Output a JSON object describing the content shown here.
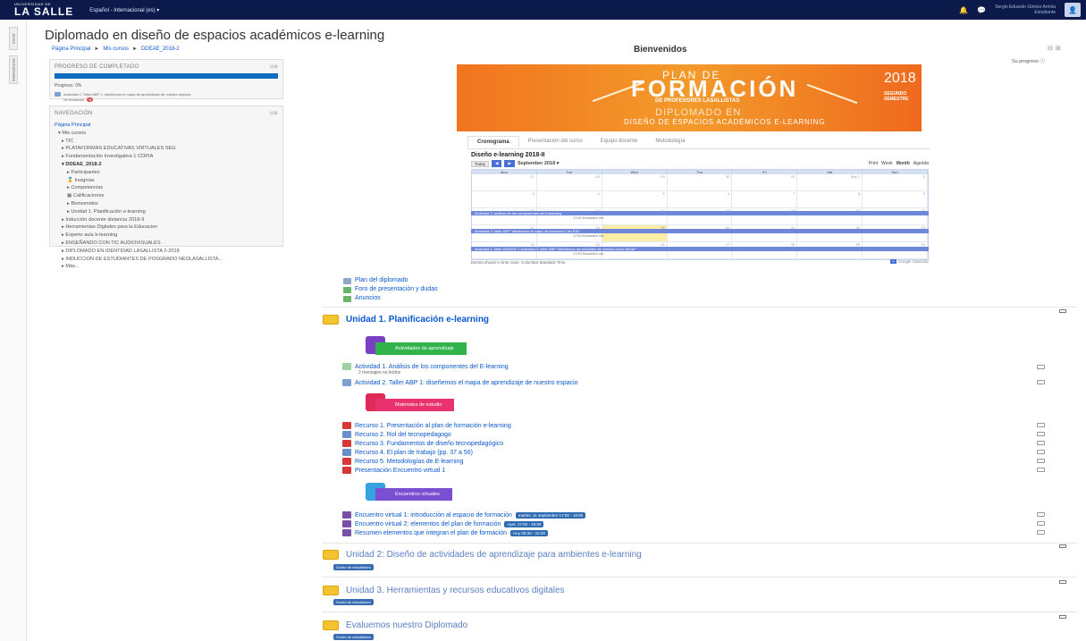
{
  "topbar": {
    "logo_top": "UNIVERSIDAD DE",
    "logo_main": "LA SALLE",
    "language": "Español - Internacional (es) ▾",
    "user_name": "Sergio Eduardo Gómez Arriola",
    "user_role": "Estudiante"
  },
  "rail": {
    "tab1": "Cerrar",
    "tab2": "Administración"
  },
  "page": {
    "title": "Diplomado en diseño de espacios académicos e-learning",
    "breadcrumb": [
      "Página Principal",
      "Mis cursos",
      "DDEAE_2018-2"
    ],
    "welcome": "Bienvenidos",
    "su_progreso": "Su progreso ⓘ"
  },
  "progress_block": {
    "title": "PROGRESO DE COMPLETADO",
    "progress_text": "Progreso: 0%",
    "item": "Actividad 2. Taller ABP 1: diseñemos el mapa de aprendizaje de nuestro espacio",
    "not_done": "No finalizado"
  },
  "nav_block": {
    "title": "NAVEGACIÓN",
    "items": [
      "Página Principal",
      "▾ Mis cursos",
      "▸ TIC",
      "▸ PLATAFORMAS EDUCATIVAS VIRTUALES SEG",
      "▸ Fundamentación Investigativa 1 COPIA",
      "▾ DDEAE_2018-2",
      "▸ Participantes",
      "🏅 Insignias",
      "▸ Competencias",
      "▦ Calificaciones",
      "▸ Bienvenidos",
      "▸ Unidad 1. Planificación e-learning",
      "▸ Inducción docente distancia 2018-II",
      "▸ Herramientas Digitales para la Educacion",
      "▸ Experto aula b-learning",
      "▸ ENSEÑANDO CON TIC AUDIOVISUALES",
      "▸ DIPLOMADO EN IDENTIDAD LASALLISTA 2-2018",
      "▸ INDUCCION DE ESTUDIANTES DE POSGRADO NEOLASALLISTA...",
      "▸ Más..."
    ]
  },
  "banner": {
    "line1": "PLAN DE",
    "line2": "FORMACIÓN",
    "line3": "DE PROFESORES LASALLISTAS",
    "line4": "DIPLOMADO EN",
    "line5": "DISEÑO DE ESPACIOS ACADÉMICOS E-LEARNING",
    "year": "2018",
    "semester": "SEGUNDO SEMESTRE"
  },
  "tabs": [
    "Cronograma",
    "Presentación del curso",
    "Equipo docente",
    "Metodología"
  ],
  "calendar": {
    "title": "Diseño e-learning 2018-II",
    "today": "Today",
    "month": "September 2018 ▾",
    "print": "Print",
    "views": [
      "Week",
      "Month",
      "Agenda"
    ],
    "days": [
      "Mon",
      "Tue",
      "Wed",
      "Thu",
      "Fri",
      "Sat",
      "Sun"
    ],
    "weeks": [
      [
        "27",
        "28",
        "29",
        "30",
        "31",
        "Sep 1",
        "2"
      ],
      [
        "3",
        "4",
        "5",
        "6",
        "7",
        "8",
        "9"
      ],
      [
        "10",
        "11",
        "12",
        "13",
        "14",
        "15",
        "16"
      ],
      [
        "17",
        "18",
        "19",
        "20",
        "21",
        "22",
        "23"
      ],
      [
        "24",
        "25",
        "26",
        "27",
        "28",
        "29",
        "30"
      ]
    ],
    "event1": "Actividad 1: análisis de los componentes del e-learning",
    "event1_sub": "17:00 Encuentro virt",
    "event2": "Actividad 2: taller ABP \"diseñemos el mapa de formación\" del EAV",
    "event2_sub": "17:00 Encuentro virt",
    "event3": "Actividad 2: taller AVANCE 1 Actividad 3: taller ABP \"diseñemos las unidades de nuestro curso virtual\"",
    "event3_sub": "17:00 Encuentro virt",
    "footer": "Events shown in time zone: Colombia Standard Time",
    "gcal": "Google Calendar"
  },
  "resources_top": [
    "Plan del diplomado",
    "Foro de presentación y dudas",
    "Anuncios"
  ],
  "unit1": {
    "title": "Unidad 1. Planificación e-learning",
    "label_activities": "Actividades de aprendizaje",
    "label_materials": "Materiales de estudio",
    "label_meetings": "Encuentros virtuales",
    "activity1": "Actividad 1. Análisis de los componentes del E-learning",
    "activity1_note": "2 mensajes no leídos",
    "activity2": "Actividad 2. Taller ABP 1: diseñemos el mapa de aprendizaje de nuestro espacio",
    "materials": [
      "Recurso 1. Presentación al plan de formación e-learning",
      "Recurso 2. Rol del tecnopedagogo",
      "Recurso 3. Fundamentos de diseño tecnopedagógico",
      "Recurso 4. El plan de trabajo (pp. 37 a 56)",
      "Recurso 5. Metodologías de E-learning",
      "Presentación Encuentro virtual 1"
    ],
    "meetings": [
      {
        "label": "Encuentro virtual 1: introducción al espacio de formación",
        "date": "martes, 11 septiembre 17:00 - 18:00"
      },
      {
        "label": "Encuentro virtual 2: elementos del plan de formación",
        "date": "Ayer, 17:00 - 18:00"
      },
      {
        "label": "Resumen elementos que integran el plan de formación",
        "date": "Hoy 00:30 - 10:30"
      }
    ]
  },
  "sections": [
    {
      "title": "Unidad 2: Diseño de actividades de aprendizaje para ambientes e-learning",
      "badge": "Oculto de estudiantes"
    },
    {
      "title": "Unidad 3. Herramientas y recursos educativos digitales",
      "badge": "Oculto de estudiantes"
    },
    {
      "title": "Evaluemos nuestro Diplomado",
      "badge": "Oculto de estudiantes"
    }
  ]
}
